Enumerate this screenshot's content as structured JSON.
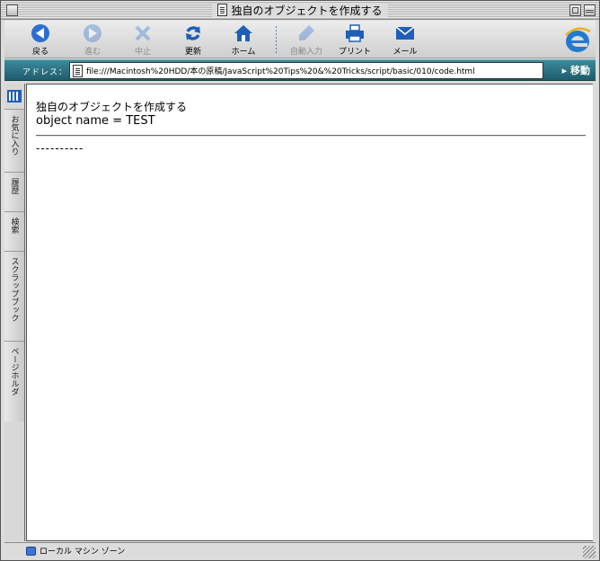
{
  "window": {
    "title": "独自のオブジェクトを作成する"
  },
  "toolbar": {
    "buttons": [
      {
        "label": "戻る",
        "icon": "back-arrow-icon",
        "enabled": true
      },
      {
        "label": "進む",
        "icon": "forward-arrow-icon",
        "enabled": false
      },
      {
        "label": "中止",
        "icon": "stop-x-icon",
        "enabled": false
      },
      {
        "label": "更新",
        "icon": "refresh-icon",
        "enabled": true
      },
      {
        "label": "ホーム",
        "icon": "home-icon",
        "enabled": true
      },
      {
        "label": "自動入力",
        "icon": "autofill-pen-icon",
        "enabled": false
      },
      {
        "label": "プリント",
        "icon": "printer-icon",
        "enabled": true
      },
      {
        "label": "メール",
        "icon": "mail-icon",
        "enabled": true
      }
    ]
  },
  "address": {
    "label": "アドレス：",
    "url": "file:///Macintosh%20HDD/本の原稿/JavaScript%20Tips%20&%20Tricks/script/basic/010/code.html",
    "go_label": "移動"
  },
  "sidebar": {
    "tabs": [
      {
        "label": "お気に入り"
      },
      {
        "label": "履歴"
      },
      {
        "label": "検索"
      },
      {
        "label": "スクラップブック"
      },
      {
        "label": "ページホルダ"
      }
    ]
  },
  "content": {
    "heading": "独自のオブジェクトを作成する",
    "output": "object name = TEST",
    "dashes": "----------"
  },
  "status": {
    "zone": "ローカル マシン ゾーン"
  },
  "colors": {
    "address_bar": "#2a6f80",
    "ie_logo": "#1f7ad0"
  }
}
